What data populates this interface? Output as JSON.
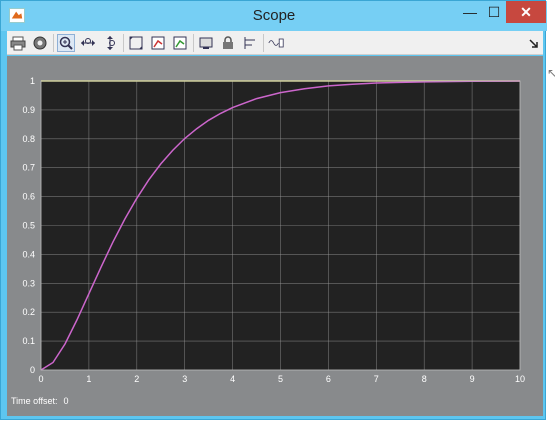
{
  "window": {
    "title": "Scope",
    "min": "—",
    "max": "☐",
    "close": "✕"
  },
  "toolbar": {
    "items": [
      "print-icon",
      "settings-icon",
      "zoom-in-icon",
      "zoom-x-icon",
      "zoom-y-icon",
      "autoscale-icon",
      "save-axes-icon",
      "restore-axes-icon",
      "floating-scope-icon",
      "lock-axes-icon",
      "signal-selection-icon",
      "legend-icon"
    ]
  },
  "footer": {
    "label": "Time offset:",
    "value": "0"
  },
  "colors": {
    "plot_bg": "#222222",
    "frame_bg": "#888a8c",
    "line": "#cc66cc",
    "ref_line": "#e8e87a",
    "grid": "#9a9a9a"
  },
  "chart_data": {
    "type": "line",
    "title": "",
    "xlabel": "",
    "ylabel": "",
    "xlim": [
      0,
      10
    ],
    "ylim": [
      0,
      1
    ],
    "x_ticks": [
      "0",
      "1",
      "2",
      "3",
      "4",
      "5",
      "6",
      "7",
      "8",
      "9",
      "10"
    ],
    "y_ticks": [
      "0",
      "0.1",
      "0.2",
      "0.3",
      "0.4",
      "0.5",
      "0.6",
      "0.7",
      "0.8",
      "0.9",
      "1"
    ],
    "grid": true,
    "series": [
      {
        "color": "#cc66cc",
        "x": [
          0,
          0.25,
          0.5,
          0.75,
          1,
          1.25,
          1.5,
          1.75,
          2,
          2.25,
          2.5,
          2.75,
          3,
          3.25,
          3.5,
          3.75,
          4,
          4.5,
          5,
          5.5,
          6,
          6.5,
          7,
          7.5,
          8,
          9,
          10
        ],
        "y": [
          0,
          0.026,
          0.09,
          0.173,
          0.264,
          0.355,
          0.442,
          0.522,
          0.594,
          0.658,
          0.713,
          0.76,
          0.801,
          0.835,
          0.864,
          0.888,
          0.908,
          0.939,
          0.96,
          0.973,
          0.983,
          0.989,
          0.993,
          0.995,
          0.997,
          0.999,
          1.0
        ]
      },
      {
        "color": "#e8e87a",
        "x": [
          0,
          10
        ],
        "y": [
          1,
          1
        ]
      }
    ]
  }
}
